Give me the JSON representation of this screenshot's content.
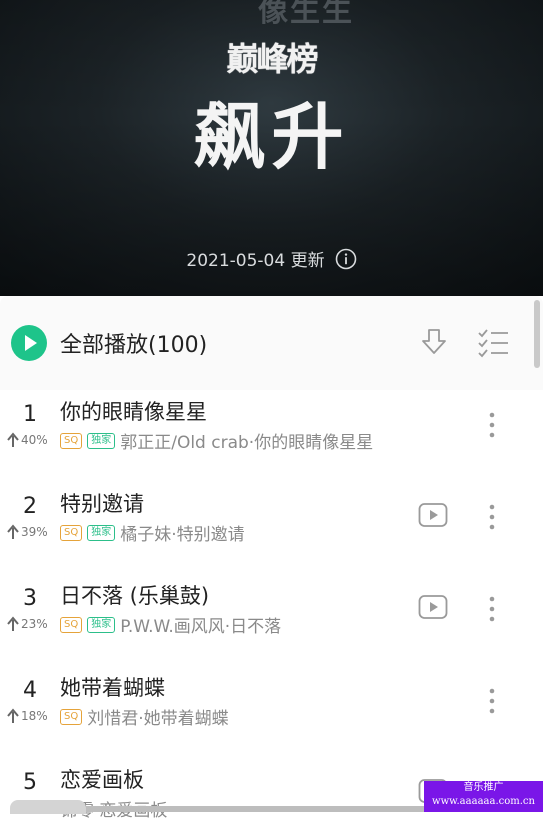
{
  "header": {
    "ghost_text": "像生生",
    "brand": "巅峰榜",
    "title": "飙升",
    "update_text": "2021-05-04 更新"
  },
  "toolbar": {
    "play_all_label": "全部播放(100)",
    "accent_color": "#1ec48a"
  },
  "songs": [
    {
      "rank": "1",
      "trend": "40%",
      "title": "你的眼睛像星星",
      "badges": [
        "SQ",
        "独家"
      ],
      "meta": "郭正正/Old crab·你的眼睛像星星",
      "has_mv": false
    },
    {
      "rank": "2",
      "trend": "39%",
      "title": "特别邀请",
      "badges": [
        "SQ",
        "独家"
      ],
      "meta": "橘子妹·特别邀请",
      "has_mv": true
    },
    {
      "rank": "3",
      "trend": "23%",
      "title": "日不落 (乐巢鼓)",
      "badges": [
        "SQ",
        "独家"
      ],
      "meta": "P.W.W.画风风·日不落",
      "has_mv": true
    },
    {
      "rank": "4",
      "trend": "18%",
      "title": "她带着蝴蝶",
      "badges": [
        "SQ"
      ],
      "meta": "刘惜君·她带着蝴蝶",
      "has_mv": false
    },
    {
      "rank": "5",
      "trend": "",
      "title": "恋爱画板",
      "badges": [],
      "meta": "锦零·恋爱画板",
      "has_mv": true
    }
  ],
  "icons": {
    "info": "info-icon",
    "play": "play-circle-icon",
    "download": "download-icon",
    "multi_select": "multi-select-icon",
    "mv": "mv-play-icon",
    "more": "more-vertical-icon",
    "trend": "arrow-up-icon"
  },
  "watermark": {
    "line1": "音乐推广",
    "line2": "www.aaaaaa.com.cn"
  }
}
